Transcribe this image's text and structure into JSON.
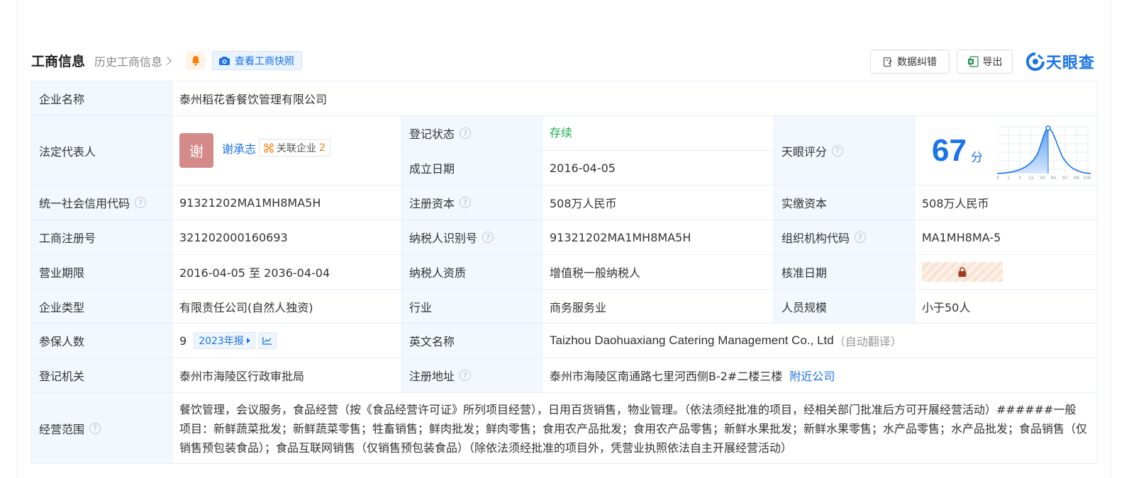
{
  "header": {
    "title": "工商信息",
    "history_label": "历史工商信息",
    "snapshot_label": "查看工商快照",
    "correct_label": "数据纠错",
    "export_label": "导出",
    "logo_text": "天眼查"
  },
  "rows": {
    "company_name": {
      "label": "企业名称",
      "value": "泰州稻花香餐饮管理有限公司"
    },
    "legal_rep": {
      "label": "法定代表人",
      "avatar_char": "谢",
      "name": "谢承志",
      "related_label": "关联企业",
      "related_count": "2"
    },
    "reg_status": {
      "label": "登记状态",
      "value": "存续"
    },
    "found_date": {
      "label": "成立日期",
      "value": "2016-04-05"
    },
    "tianyan_score": {
      "label": "天眼评分",
      "score": "67",
      "unit": "分",
      "axis_ticks": [
        "0",
        "1",
        "3",
        "15",
        "50",
        "85",
        "97",
        "99",
        "100"
      ]
    },
    "credit_code": {
      "label": "统一社会信用代码",
      "value": "91321202MA1MH8MA5H"
    },
    "reg_capital": {
      "label": "注册资本",
      "value": "508万人民币"
    },
    "paid_capital": {
      "label": "实缴资本",
      "value": "508万人民币"
    },
    "reg_number": {
      "label": "工商注册号",
      "value": "321202000160693"
    },
    "taxpayer_id": {
      "label": "纳税人识别号",
      "value": "91321202MA1MH8MA5H"
    },
    "org_code": {
      "label": "组织机构代码",
      "value": "MA1MH8MA-5"
    },
    "business_term": {
      "label": "营业期限",
      "value": "2016-04-05 至 2036-04-04"
    },
    "tax_qualification": {
      "label": "纳税人资质",
      "value": "增值税一般纳税人"
    },
    "approval_date": {
      "label": "核准日期"
    },
    "company_type": {
      "label": "企业类型",
      "value": "有限责任公司(自然人独资)"
    },
    "industry": {
      "label": "行业",
      "value": "商务服务业"
    },
    "staff_size": {
      "label": "人员规模",
      "value": "小于50人"
    },
    "insured": {
      "label": "参保人数",
      "value": "9",
      "report_label": "2023年报"
    },
    "english_name": {
      "label": "英文名称",
      "value": "Taizhou Daohuaxiang Catering Management Co., Ltd",
      "note": "（自动翻译）"
    },
    "reg_authority": {
      "label": "登记机关",
      "value": "泰州市海陵区行政审批局"
    },
    "reg_address": {
      "label": "注册地址",
      "value": "泰州市海陵区南通路七里河西侧B-2#二楼三楼",
      "nearby_label": "附近公司"
    },
    "business_scope": {
      "label": "经营范围",
      "value": "餐饮管理，会议服务，食品经营（按《食品经营许可证》所列项目经营），日用百货销售，物业管理。（依法须经批准的项目，经相关部门批准后方可开展经营活动）######一般项目：新鲜蔬菜批发；新鲜蔬菜零售；牲畜销售；鲜肉批发；鲜肉零售；食用农产品批发；食用农产品零售；新鲜水果批发；新鲜水果零售；水产品零售；水产品批发；食品销售（仅销售预包装食品）；食品互联网销售（仅销售预包装食品）（除依法须经批准的项目外，凭营业执照依法自主开展经营活动）"
    }
  },
  "colors": {
    "accent": "#1a73e8",
    "status_green": "#1eac54",
    "label_bg": "#f2f8fe",
    "border": "#e6eef8"
  }
}
